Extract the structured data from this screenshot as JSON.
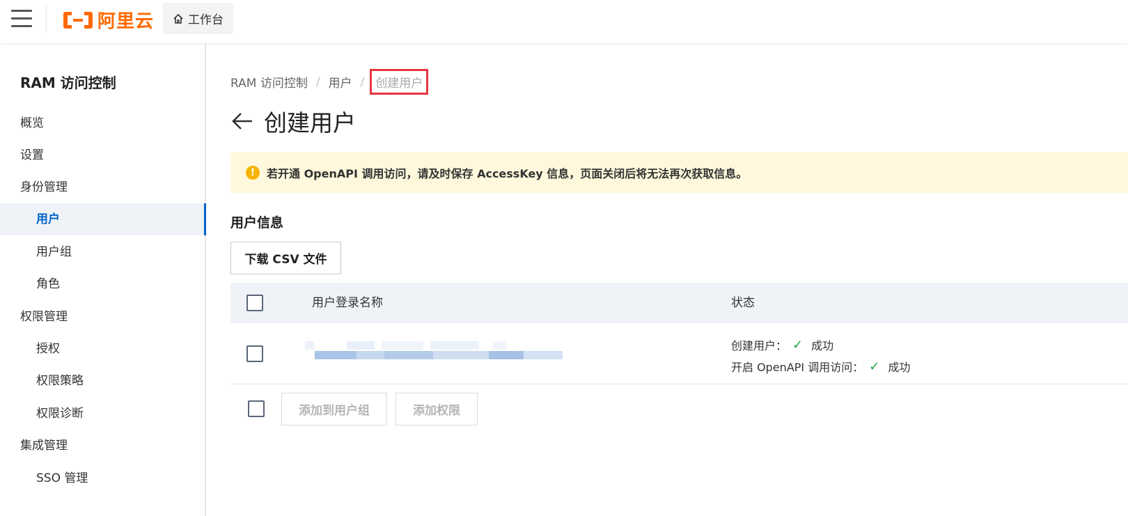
{
  "header": {
    "logo_text": "阿里云",
    "workbench_label": "工作台",
    "brand_color": "#ff6a00"
  },
  "sidebar": {
    "title": "RAM 访问控制",
    "items": [
      {
        "label": "概览",
        "level": 1,
        "active": false
      },
      {
        "label": "设置",
        "level": 1,
        "active": false
      },
      {
        "label": "身份管理",
        "level": 1,
        "active": false
      },
      {
        "label": "用户",
        "level": 2,
        "active": true
      },
      {
        "label": "用户组",
        "level": 2,
        "active": false
      },
      {
        "label": "角色",
        "level": 2,
        "active": false
      },
      {
        "label": "权限管理",
        "level": 1,
        "active": false
      },
      {
        "label": "授权",
        "level": 2,
        "active": false
      },
      {
        "label": "权限策略",
        "level": 2,
        "active": false
      },
      {
        "label": "权限诊断",
        "level": 2,
        "active": false
      },
      {
        "label": "集成管理",
        "level": 1,
        "active": false
      },
      {
        "label": "SSO 管理",
        "level": 2,
        "active": false
      }
    ]
  },
  "breadcrumb": {
    "items": [
      "RAM 访问控制",
      "用户",
      "创建用户"
    ]
  },
  "page": {
    "title": "创建用户",
    "alert": "若开通 OpenAPI 调用访问，请及时保存 AccessKey 信息，页面关闭后将无法再次获取信息。",
    "section_title": "用户信息",
    "download_button": "下载 CSV 文件"
  },
  "table": {
    "columns": [
      "用户登录名称",
      "状态"
    ],
    "rows": [
      {
        "login_name_redacted": true,
        "status": [
          {
            "label": "创建用户：",
            "result": "成功"
          },
          {
            "label": "开启 OpenAPI 调用访问：",
            "result": "成功"
          }
        ]
      }
    ]
  },
  "footer": {
    "add_to_group_button": "添加到用户组",
    "add_permission_button": "添加权限"
  },
  "colors": {
    "accent": "#0064c8",
    "success": "#1aa33e",
    "alert_bg": "#fff8dc",
    "highlight_border": "#e6353f"
  }
}
